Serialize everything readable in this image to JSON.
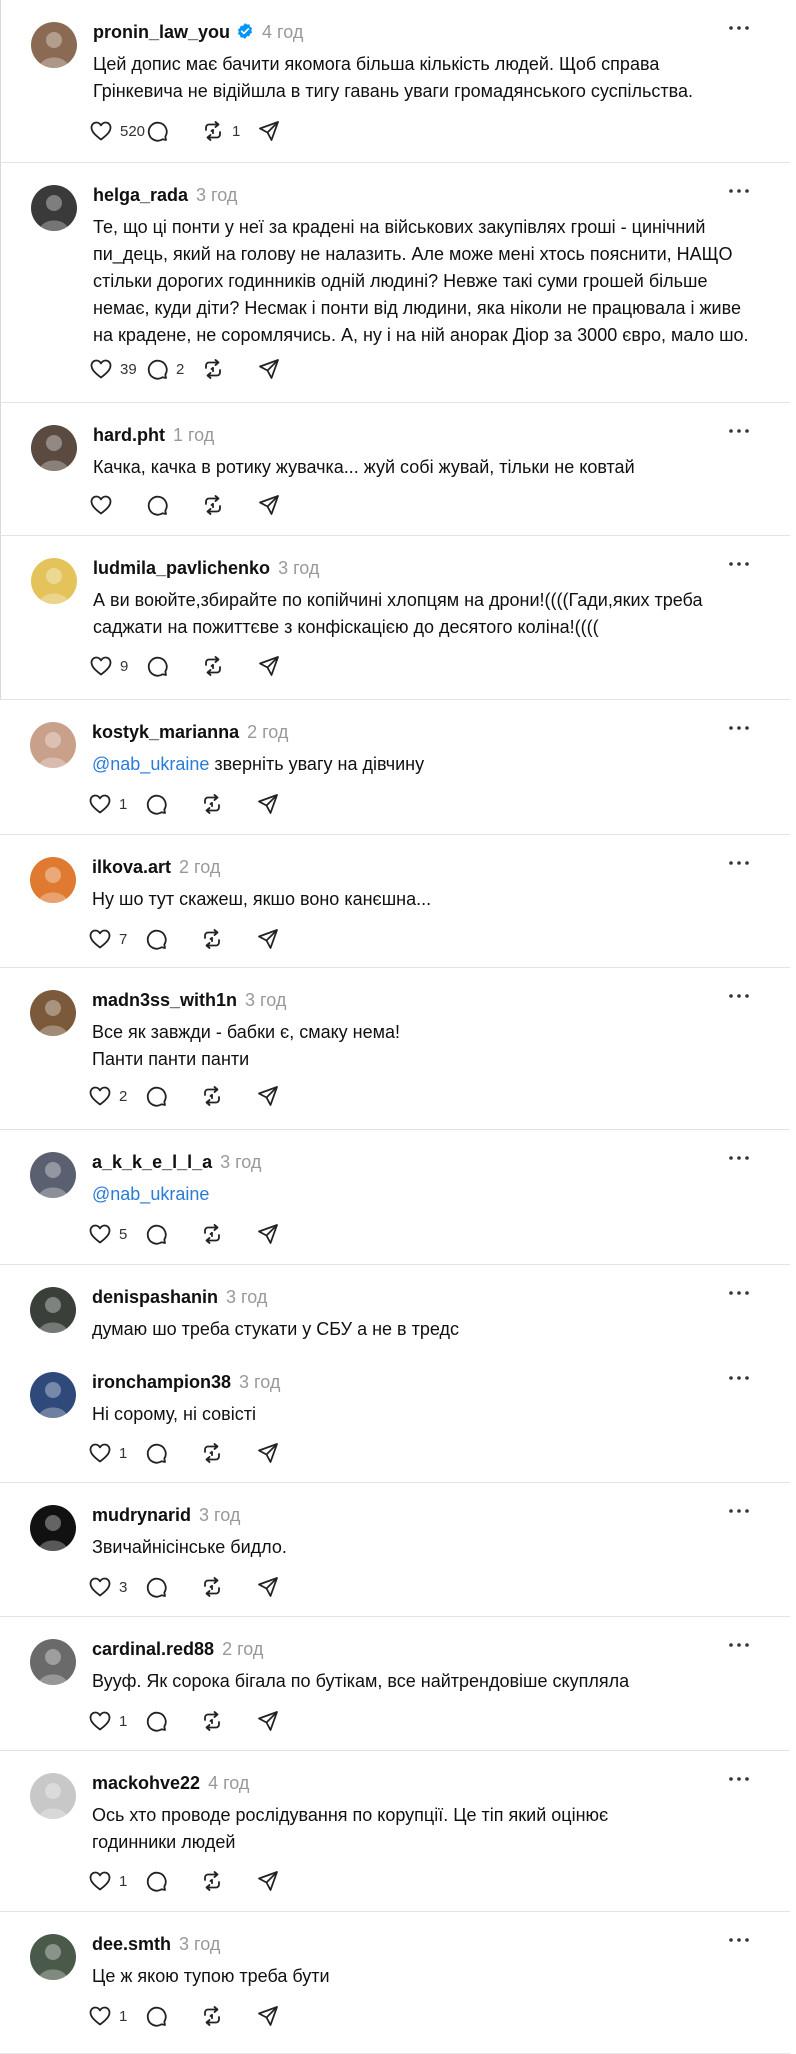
{
  "posts": [
    {
      "username": "pronin_law_you",
      "verified": true,
      "time": "4 год",
      "lines": [
        "Цей допис має бачити якомога більша кількість людей. Щоб справа",
        "Грінкевича не відійшла в тигу гавань уваги громадянського суспільства."
      ],
      "likes": "520",
      "replies": "",
      "reposts": "1",
      "avatar_color": "#8a6a52"
    },
    {
      "username": "helga_rada",
      "verified": false,
      "time": "3 год",
      "lines": [
        "Те, що ці понти у неї за крадені на військових закупівлях гроші - цинічний",
        "пи_дець, який на голову не налазить. Але може мені хтось пояснити, НАЩО",
        "стільки дорогих годинників одній людині? Невже такі суми грошей більше",
        "немає, куди діти? Несмак і понти від людини, яка ніколи не працювала і живе",
        "на крадене, не соромлячись. А, ну і на ній анорак Діор за 3000 євро, мало шо."
      ],
      "likes": "39",
      "replies": "2",
      "reposts": "",
      "avatar_color": "#3a3a3a"
    },
    {
      "username": "hard.pht",
      "verified": false,
      "time": "1 год",
      "lines": [
        "Качка, качка в ротику жувачка... жуй собі жувай, тільки не ковтай"
      ],
      "likes": "",
      "replies": "",
      "reposts": "",
      "avatar_color": "#5a4a40"
    },
    {
      "username": "ludmila_pavlichenko",
      "verified": false,
      "time": "3 год",
      "lines": [
        "А ви воюйте,збирайте по копійчині хлопцям на дрони!((((Гади,яких треба",
        "саджати на пожиттєве з конфіскацією до десятого коліна!(((("
      ],
      "likes": "9",
      "replies": "",
      "reposts": "",
      "avatar_color": "#e3c35a"
    },
    {
      "username": "kostyk_marianna",
      "verified": false,
      "time": "2 год",
      "mention": "@nab_ukraine",
      "lines": [
        "зверніть увагу на дівчину"
      ],
      "likes": "1",
      "replies": "",
      "reposts": "",
      "avatar_color": "#c9a08a"
    },
    {
      "username": "ilkova.art",
      "verified": false,
      "time": "2 год",
      "lines": [
        "Ну шо тут скажеш, якшо воно канєшна..."
      ],
      "likes": "7",
      "replies": "",
      "reposts": "",
      "avatar_color": "#e07a30"
    },
    {
      "username": "madn3ss_with1n",
      "verified": false,
      "time": "3 год",
      "lines": [
        "Все як завжди - бабки є, смаку нема!",
        "Панти панти панти"
      ],
      "likes": "2",
      "replies": "",
      "reposts": "",
      "avatar_color": "#7a5a3a"
    },
    {
      "username": "a_k_k_e_l_l_a",
      "verified": false,
      "time": "3 год",
      "mention": "@nab_ukraine",
      "lines": [
        ""
      ],
      "likes": "5",
      "replies": "",
      "reposts": "",
      "avatar_color": "#5a6070"
    },
    {
      "username": "denispashanin",
      "verified": false,
      "time": "3 год",
      "lines": [
        "думаю шо треба стукати у СБУ а не в тредс"
      ],
      "likes": "",
      "replies": "",
      "reposts": "",
      "avatar_color": "#3a3f3a"
    },
    {
      "username": "ironchampion38",
      "verified": false,
      "time": "3 год",
      "lines": [
        "Ні сорому, ні совісті"
      ],
      "likes": "1",
      "replies": "",
      "reposts": "",
      "avatar_color": "#2f4a7a"
    },
    {
      "username": "mudrynarid",
      "verified": false,
      "time": "3 год",
      "lines": [
        "Звичайнісінське бидло."
      ],
      "likes": "3",
      "replies": "",
      "reposts": "",
      "avatar_color": "#111111"
    },
    {
      "username": "cardinal.red88",
      "verified": false,
      "time": "2 год",
      "lines": [
        "Вууф. Як сорока бігала по бутікам, все найтрендовіше скупляла"
      ],
      "likes": "1",
      "replies": "",
      "reposts": "",
      "avatar_color": "#6a6a6a"
    },
    {
      "username": "mackohve22",
      "verified": false,
      "time": "4 год",
      "lines": [
        "Ось хто проводе рослідування по корупції. Це тіп який оцінює",
        "годинники людей"
      ],
      "likes": "1",
      "replies": "",
      "reposts": "",
      "avatar_color": "#c8c8c8"
    },
    {
      "username": "dee.smth",
      "verified": false,
      "time": "3 год",
      "lines": [
        "Це ж якою тупою треба бути"
      ],
      "likes": "1",
      "replies": "",
      "reposts": "",
      "avatar_color": "#4a5a4a"
    }
  ]
}
